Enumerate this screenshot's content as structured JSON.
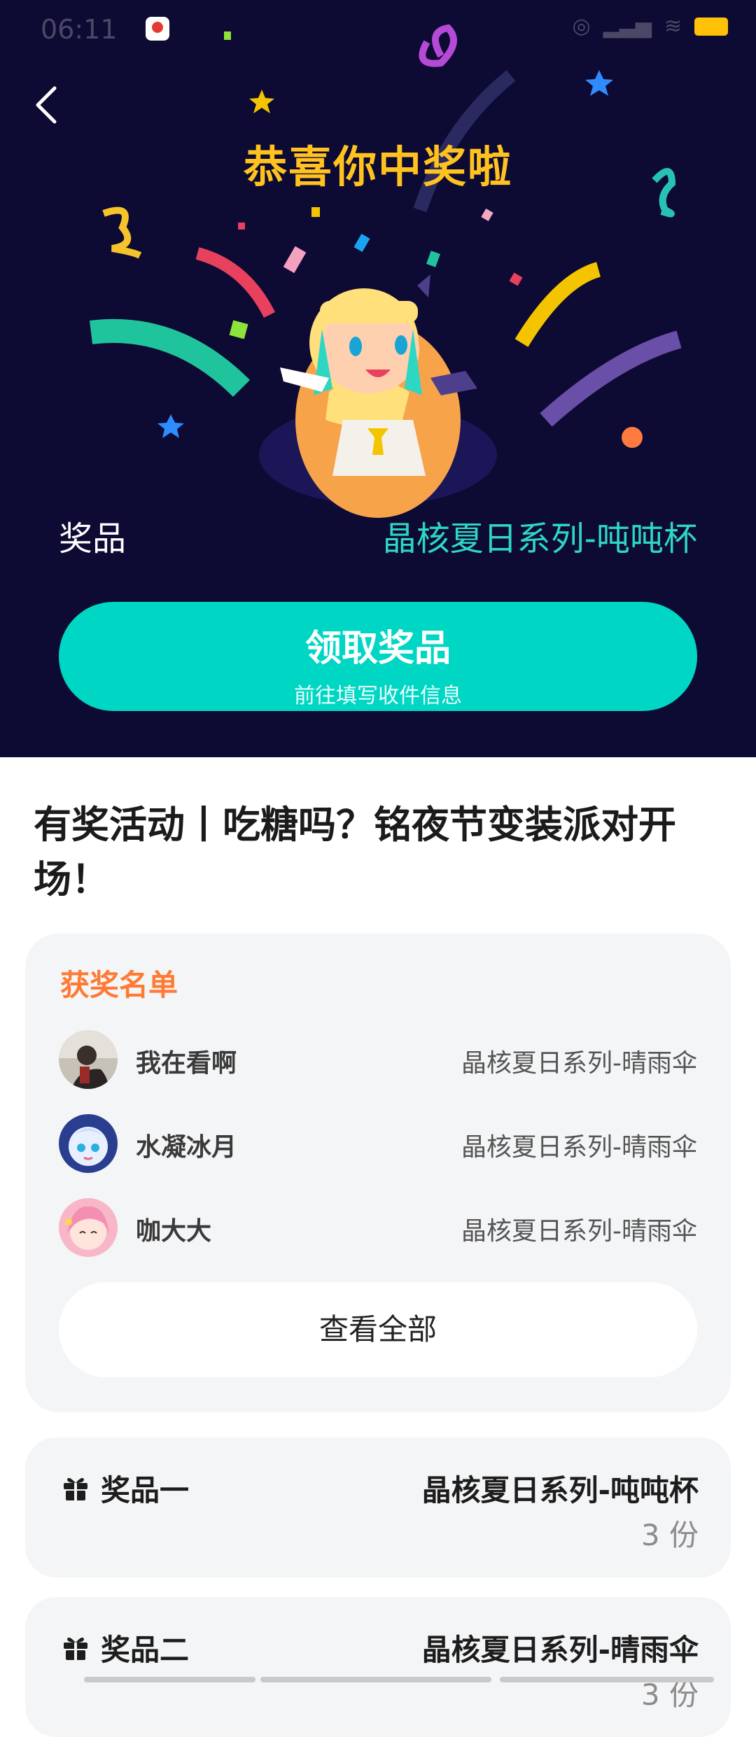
{
  "status_bar": {
    "time": "06:11"
  },
  "hero": {
    "title": "恭喜你中奖啦",
    "prize_label": "奖品",
    "prize_value": "晶核夏日系列-吨吨杯",
    "claim_button": {
      "title": "领取奖品",
      "subtitle": "前往填写收件信息"
    }
  },
  "event": {
    "title": "有奖活动丨吃糖吗？铭夜节变装派对开场！"
  },
  "winners": {
    "heading": "获奖名单",
    "list": [
      {
        "name": "我在看啊",
        "prize": "晶核夏日系列-晴雨伞"
      },
      {
        "name": "水凝冰月",
        "prize": "晶核夏日系列-晴雨伞"
      },
      {
        "name": "咖大大",
        "prize": "晶核夏日系列-晴雨伞"
      }
    ],
    "view_all": "查看全部"
  },
  "prizes": [
    {
      "label": "奖品一",
      "name": "晶核夏日系列-吨吨杯",
      "qty": "3 份"
    },
    {
      "label": "奖品二",
      "name": "晶核夏日系列-晴雨伞",
      "qty": "3 份"
    }
  ],
  "colors": {
    "hero_bg": "#0d0a33",
    "accent": "#00d6c4",
    "title_gold": "#ffc21f",
    "winner_heading": "#ff7a34"
  }
}
